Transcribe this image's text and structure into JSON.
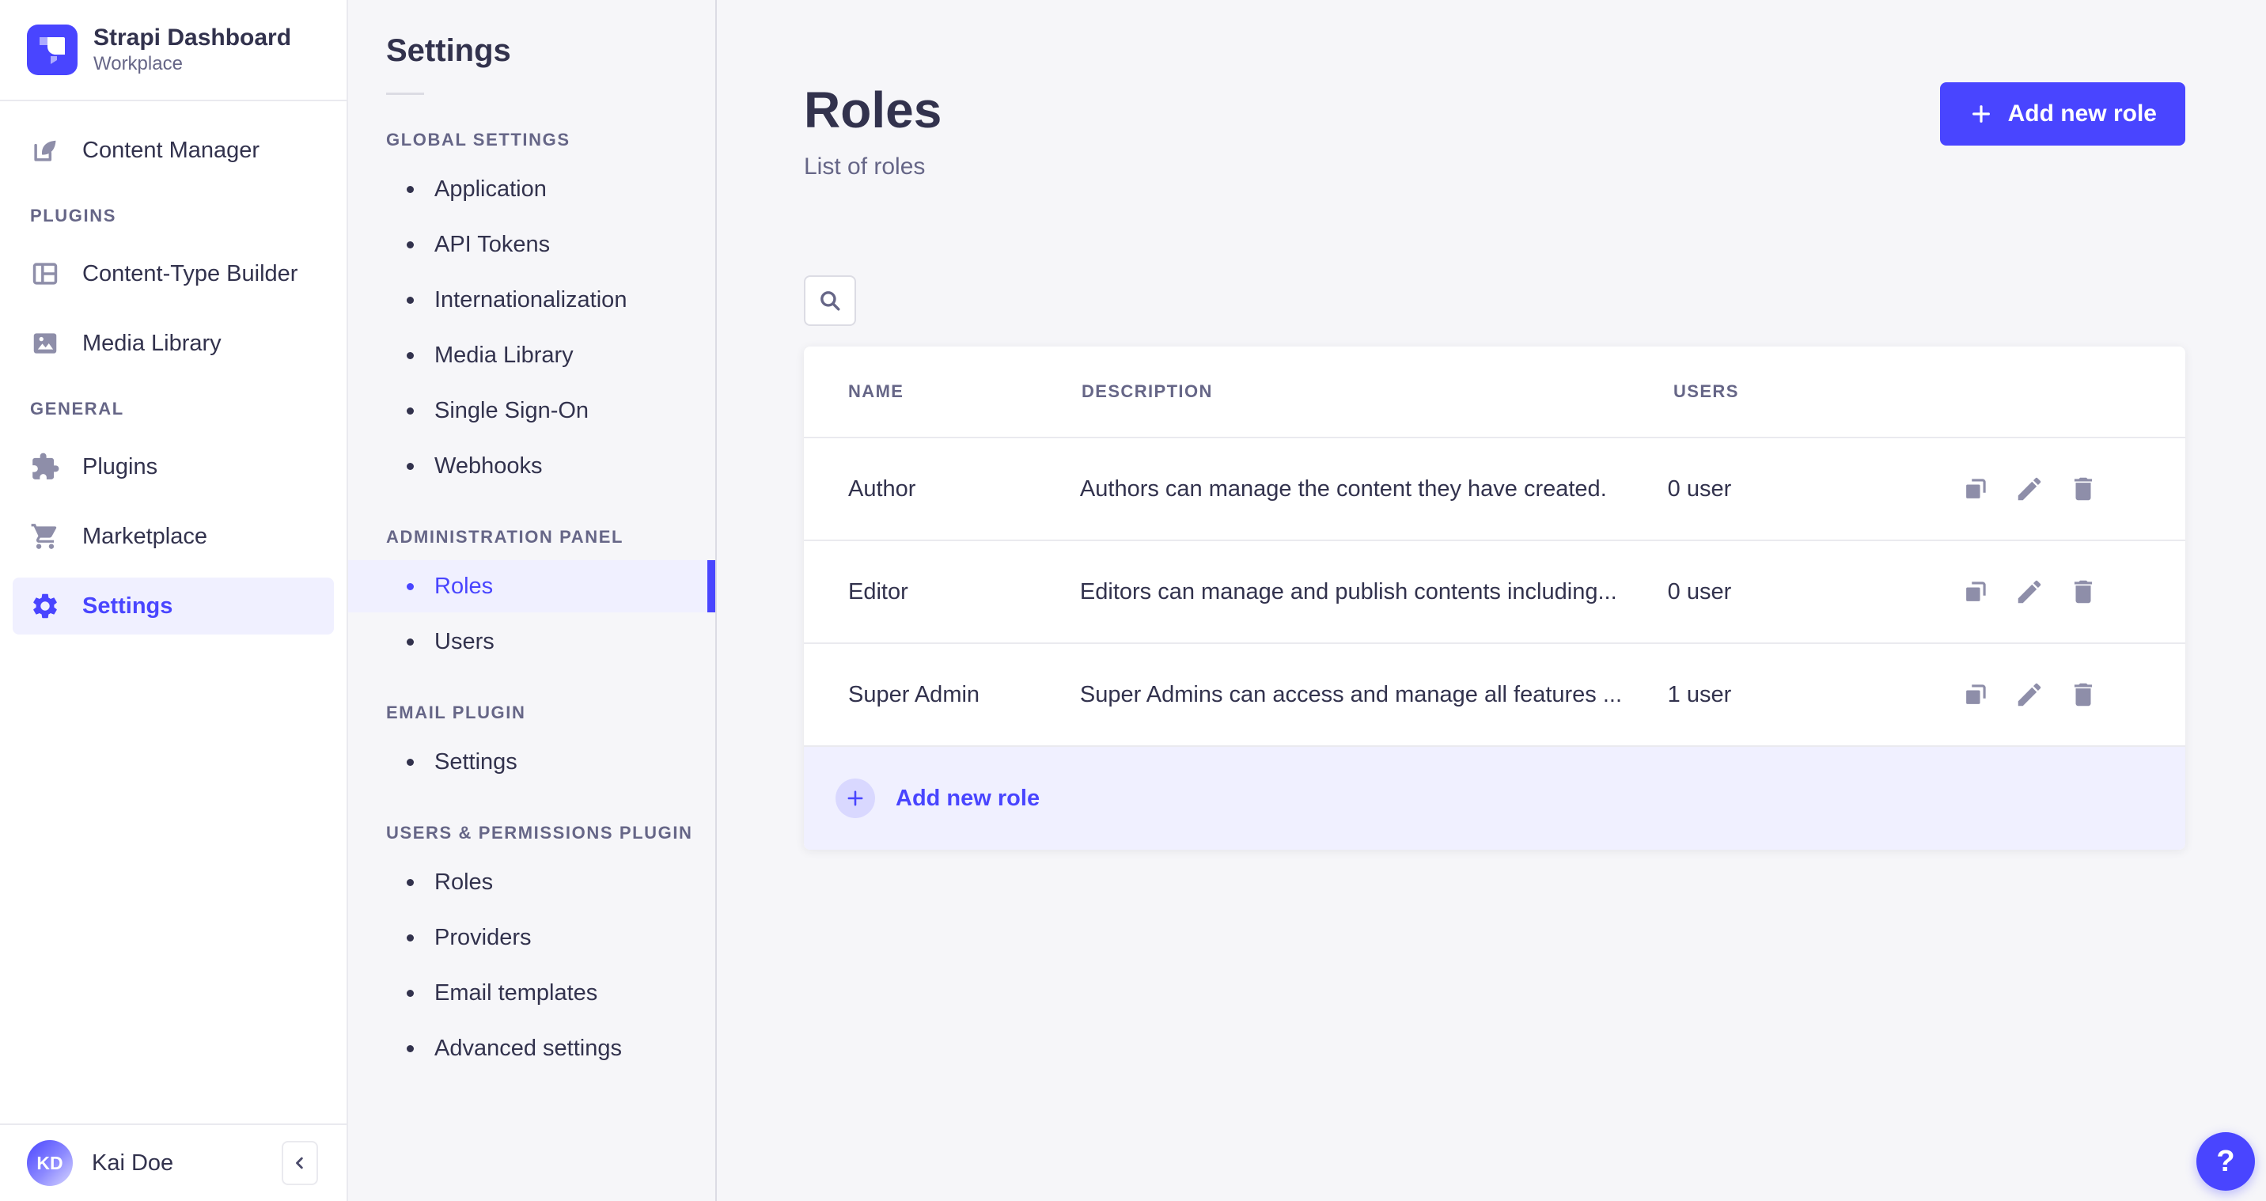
{
  "colors": {
    "accent": "#4945FF",
    "accent_soft_bg": "#F0F0FF",
    "accent_circle": "#D9D8FF",
    "text_dark": "#32324D",
    "text_secondary": "#666687",
    "icon_grey": "#8E8EA9",
    "border": "#EAEAEF",
    "page_bg": "#F6F6F9"
  },
  "brand": {
    "app_name": "Strapi Dashboard",
    "workspace": "Workplace",
    "logo_icon": "strapi-logo-icon"
  },
  "sidebar": {
    "items": [
      {
        "label": "Content Manager",
        "icon": "feather-pen-icon"
      }
    ],
    "sections": [
      {
        "label": "PLUGINS",
        "items": [
          {
            "label": "Content-Type Builder",
            "icon": "layout-icon"
          },
          {
            "label": "Media Library",
            "icon": "picture-icon"
          }
        ]
      },
      {
        "label": "GENERAL",
        "items": [
          {
            "label": "Plugins",
            "icon": "puzzle-icon"
          },
          {
            "label": "Marketplace",
            "icon": "cart-icon"
          },
          {
            "label": "Settings",
            "icon": "gear-icon",
            "active": true
          }
        ]
      }
    ],
    "user": {
      "initials": "KD",
      "name": "Kai Doe"
    },
    "collapse_icon": "chevron-left-icon"
  },
  "settings_nav": {
    "title": "Settings",
    "sections": [
      {
        "label": "GLOBAL SETTINGS",
        "items": [
          {
            "label": "Application"
          },
          {
            "label": "API Tokens"
          },
          {
            "label": "Internationalization"
          },
          {
            "label": "Media Library"
          },
          {
            "label": "Single Sign-On"
          },
          {
            "label": "Webhooks"
          }
        ]
      },
      {
        "label": "ADMINISTRATION PANEL",
        "items": [
          {
            "label": "Roles",
            "active": true
          },
          {
            "label": "Users"
          }
        ]
      },
      {
        "label": "EMAIL PLUGIN",
        "items": [
          {
            "label": "Settings"
          }
        ]
      },
      {
        "label": "USERS & PERMISSIONS PLUGIN",
        "items": [
          {
            "label": "Roles"
          },
          {
            "label": "Providers"
          },
          {
            "label": "Email templates"
          },
          {
            "label": "Advanced settings"
          }
        ]
      }
    ]
  },
  "main": {
    "title": "Roles",
    "subtitle": "List of roles",
    "add_button": {
      "label": "Add new role",
      "icon": "plus-icon"
    },
    "search_icon": "search-icon",
    "table": {
      "headers": [
        "NAME",
        "DESCRIPTION",
        "USERS"
      ],
      "rows": [
        {
          "name": "Author",
          "description": "Authors can manage the content they have created.",
          "users": "0 user"
        },
        {
          "name": "Editor",
          "description": "Editors can manage and publish contents including...",
          "users": "0 user"
        },
        {
          "name": "Super Admin",
          "description": "Super Admins can access and manage all features ...",
          "users": "1 user"
        }
      ],
      "row_actions": [
        "duplicate-icon",
        "edit-icon",
        "delete-icon"
      ],
      "footer": {
        "label": "Add new role",
        "icon": "plus-icon"
      }
    }
  },
  "help": {
    "label": "?",
    "icon": "question-mark-icon"
  }
}
